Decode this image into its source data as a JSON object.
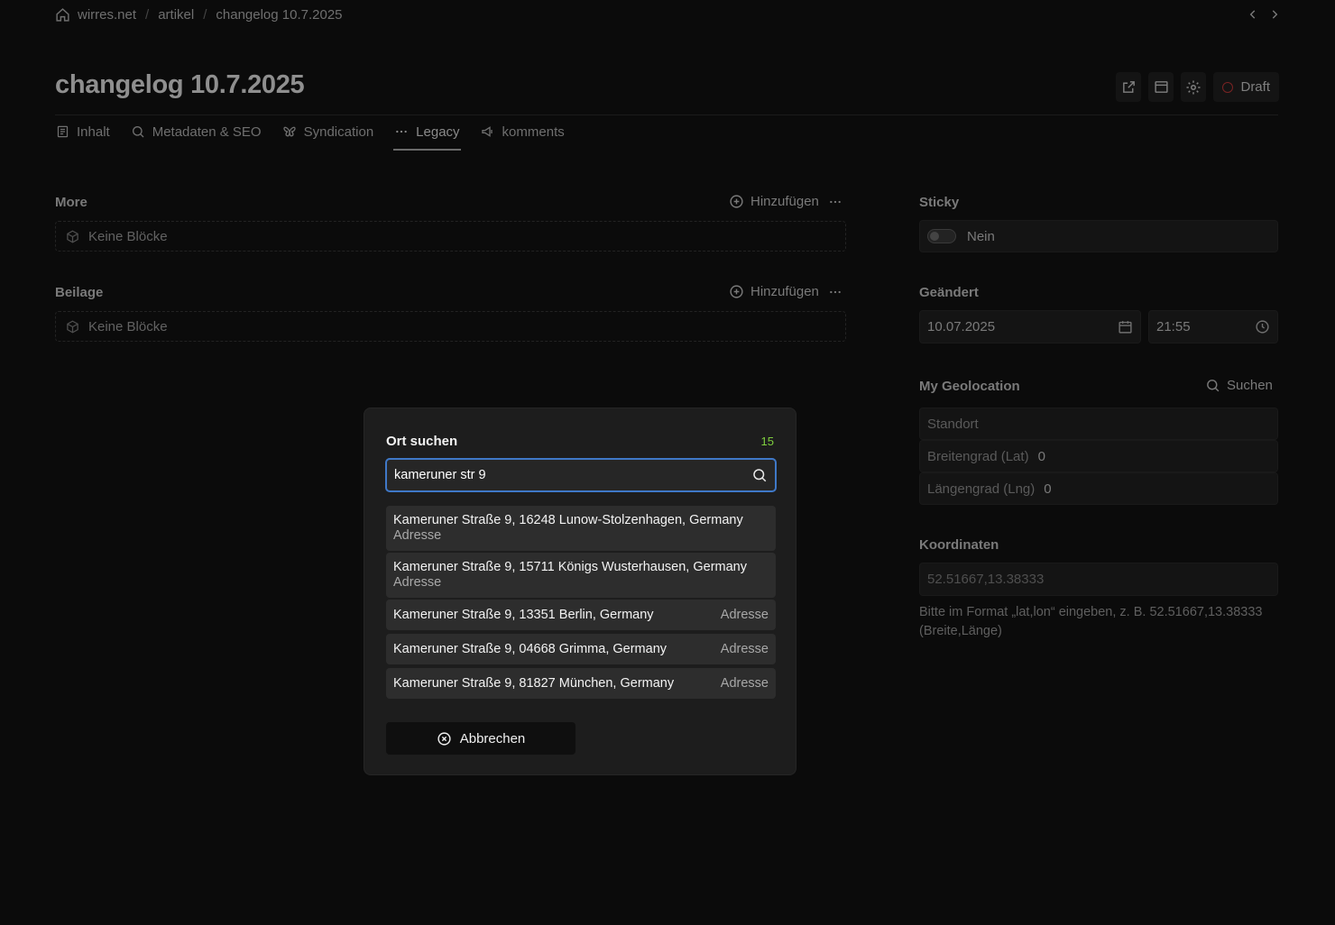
{
  "breadcrumb": {
    "items": [
      "wirres.net",
      "artikel",
      "changelog 10.7.2025"
    ],
    "separator": "/"
  },
  "page": {
    "title": "changelog 10.7.2025",
    "status_label": "Draft"
  },
  "tabs": [
    {
      "label": "Inhalt",
      "icon": "document-icon"
    },
    {
      "label": "Metadaten & SEO",
      "icon": "search-icon"
    },
    {
      "label": "Syndication",
      "icon": "butterfly-icon"
    },
    {
      "label": "Legacy",
      "icon": "ellipsis-icon",
      "active": true
    },
    {
      "label": "komments",
      "icon": "megaphone-icon"
    }
  ],
  "left": {
    "more": {
      "label": "More",
      "add_label": "Hinzufügen",
      "empty_label": "Keine Blöcke"
    },
    "beilage": {
      "label": "Beilage",
      "add_label": "Hinzufügen",
      "empty_label": "Keine Blöcke"
    }
  },
  "right": {
    "sticky": {
      "label": "Sticky",
      "value_label": "Nein"
    },
    "geaendert": {
      "label": "Geändert",
      "date": "10.07.2025",
      "time": "21:55"
    },
    "geolocation": {
      "label": "My Geolocation",
      "search_label": "Suchen",
      "standort_placeholder": "Standort",
      "lat_label": "Breitengrad (Lat)",
      "lat_value": "0",
      "lng_label": "Längengrad (Lng)",
      "lng_value": "0"
    },
    "koordinaten": {
      "label": "Koordinaten",
      "placeholder": "52.51667,13.38333",
      "help": "Bitte im Format „lat,lon“ eingeben, z. B. 52.51667,13.38333 (Breite,Länge)"
    }
  },
  "modal": {
    "title": "Ort suchen",
    "count": "15",
    "query": "kameruner str 9",
    "results": [
      {
        "address": "Kameruner Straße 9, 16248 Lunow-Stolzenhagen, Germany",
        "type": "Adresse"
      },
      {
        "address": "Kameruner Straße 9, 15711 Königs Wusterhausen, Germany",
        "type": "Adresse"
      },
      {
        "address": "Kameruner Straße 9, 13351 Berlin, Germany",
        "type": "Adresse"
      },
      {
        "address": "Kameruner Straße 9, 04668 Grimma, Germany",
        "type": "Adresse"
      },
      {
        "address": "Kameruner Straße 9, 81827 München, Germany",
        "type": "Adresse"
      }
    ],
    "cancel_label": "Abbrechen"
  },
  "colors": {
    "accent_focus": "#3f78c7",
    "count_green": "#7fcf3e",
    "draft_red": "#7a2323"
  }
}
